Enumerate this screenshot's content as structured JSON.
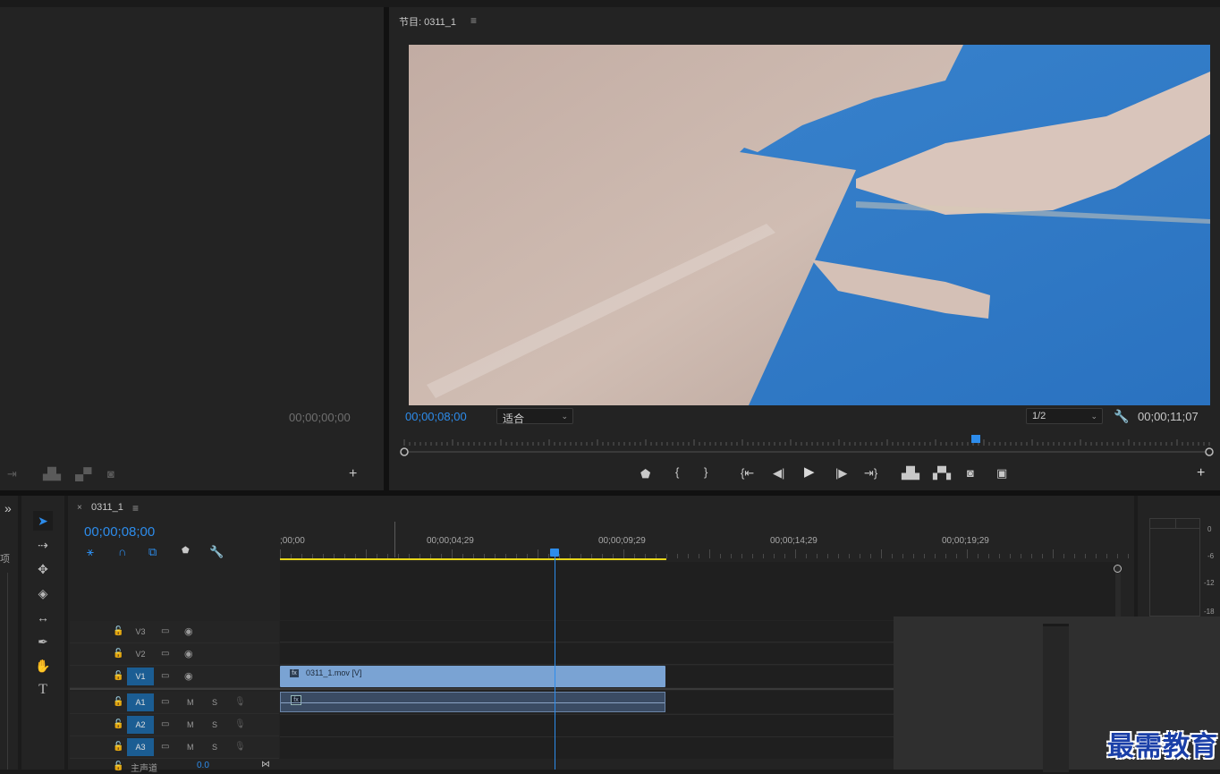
{
  "source_monitor": {
    "timecode": "00;00;00;00",
    "buttons": [
      "insert-icon",
      "lift-icon",
      "extract-icon",
      "camera-icon",
      "plus-icon"
    ]
  },
  "program_monitor": {
    "title": "节目: 0311_1",
    "menu_icon": "≡",
    "current_timecode": "00;00;08;00",
    "fit_label": "适合",
    "resolution_label": "1/2",
    "duration_timecode": "00;00;11;07",
    "playhead_fraction": 0.71,
    "transport": [
      "marker",
      "in-point",
      "out-point",
      "go-to-in",
      "step-back",
      "play",
      "step-forward",
      "go-to-out",
      "lift",
      "extract",
      "export-frame",
      "compare"
    ]
  },
  "timeline": {
    "tab_close": "×",
    "tab_title": "0311_1",
    "tab_menu": "≡",
    "current_timecode": "00;00;08;00",
    "ruler_labels": [
      ";00;00",
      "00;00;04;29",
      "00;00;09;29",
      "00;00;14;29",
      "00;00;19;29"
    ],
    "tracks": [
      {
        "name": "V3",
        "active": false,
        "kind": "video"
      },
      {
        "name": "V2",
        "active": false,
        "kind": "video"
      },
      {
        "name": "V1",
        "active": true,
        "kind": "video"
      },
      {
        "name": "A1",
        "active": true,
        "kind": "audio"
      },
      {
        "name": "A2",
        "active": true,
        "kind": "audio"
      },
      {
        "name": "A3",
        "active": true,
        "kind": "audio"
      }
    ],
    "master_label": "主声道",
    "master_value": "0.0",
    "m_label": "M",
    "s_label": "S",
    "video_clip": {
      "fx": "fx",
      "name": "0311_1.mov [V]"
    },
    "audio_clip": {
      "fx": "fx"
    }
  },
  "audio_meter": {
    "scale": [
      "0",
      "-6",
      "-12",
      "-18"
    ]
  },
  "left_edge": {
    "chevron": "»",
    "project_cut_label": "项"
  },
  "watermark": {
    "text": "最需教育"
  },
  "colors": {
    "accent_blue": "#2d8ceb",
    "clip_video": "#7aa3d3",
    "clip_audio": "#3a4b63",
    "in_out_bar": "#e7d51a"
  }
}
